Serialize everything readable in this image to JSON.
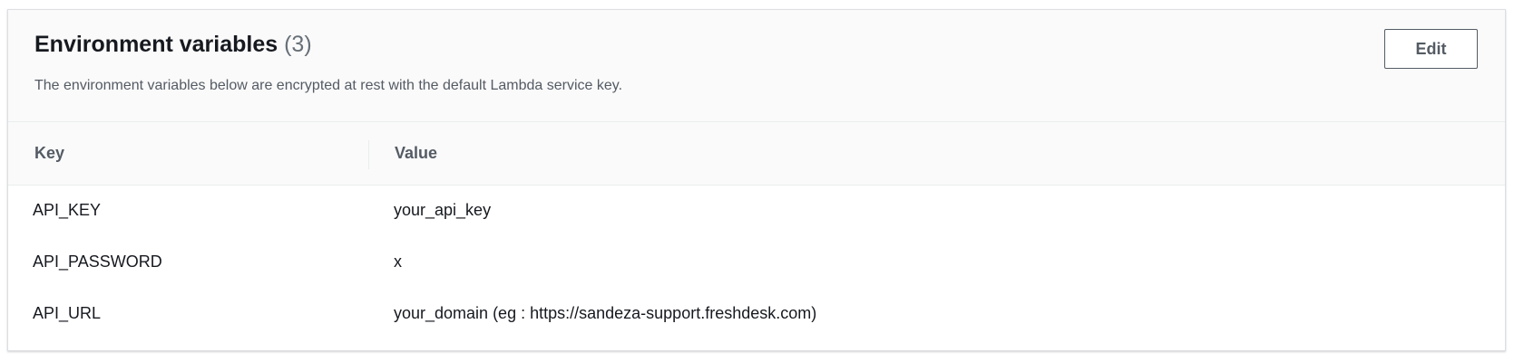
{
  "header": {
    "title": "Environment variables",
    "count": "(3)",
    "description": "The environment variables below are encrypted at rest with the default Lambda service key.",
    "edit_label": "Edit"
  },
  "table": {
    "columns": [
      "Key",
      "Value"
    ],
    "rows": [
      {
        "key": "API_KEY",
        "value": "your_api_key"
      },
      {
        "key": "API_PASSWORD",
        "value": "x"
      },
      {
        "key": "API_URL",
        "value": "your_domain (eg : https://sandeza-support.freshdesk.com)"
      }
    ]
  },
  "colors": {
    "border": "#545b64",
    "heading_text": "#16191f",
    "muted_text": "#687078",
    "header_bg": "#fafafa"
  }
}
